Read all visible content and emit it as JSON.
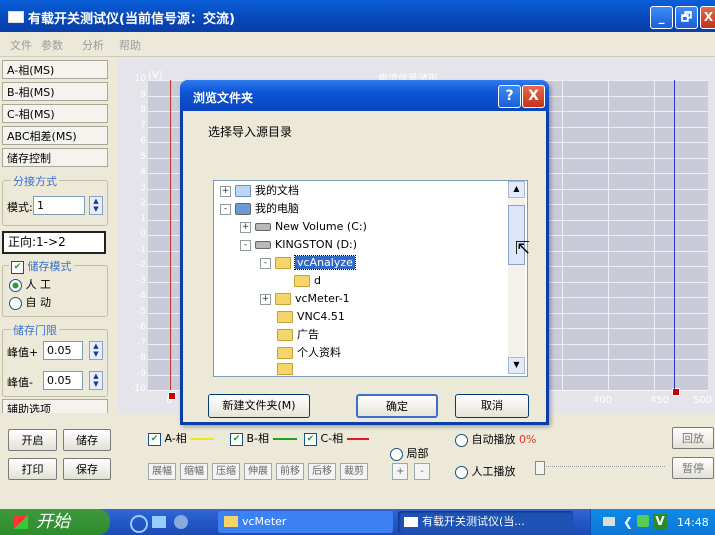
{
  "main_window": {
    "title": "有载开关测试仪(当前信号源：交流)",
    "controls": {
      "minimize": "_",
      "maximize": "🗗",
      "close": "X"
    }
  },
  "menu": [
    "文件",
    "参数",
    "分析",
    "帮助"
  ],
  "left_panel": {
    "buttons": [
      "A-相(MS)",
      "B-相(MS)",
      "C-相(MS)",
      "ABC相差(MS)",
      "储存控制"
    ],
    "split_group": {
      "label": "分接方式",
      "mode_label": "模式:",
      "mode_value": "1"
    },
    "direction": "正向:1->2",
    "storage_mode": {
      "label": "储存模式",
      "options": [
        "人 工",
        "自 动"
      ],
      "selected": 0
    },
    "threshold_group": {
      "label": "储存门限",
      "peak_plus_label": "峰值+",
      "peak_plus_value": "0.05",
      "peak_minus_label": "峰值-",
      "peak_minus_value": "0.05"
    },
    "aux": "辅助选项"
  },
  "chart": {
    "unit_label": "(V)",
    "chart_title": "电流信号波形",
    "yticks": [
      "10",
      "9",
      "8",
      "7",
      "6",
      "5",
      "4",
      "3",
      "2",
      "1",
      "0",
      "-1",
      "-2",
      "-3",
      "-4",
      "-5",
      "-6",
      "-7",
      "-8",
      "-9",
      "-10"
    ],
    "xticks": [
      "0",
      "400",
      "450",
      "500"
    ]
  },
  "bottom": {
    "buttons": {
      "start": "开启",
      "store": "储存",
      "print": "打印",
      "save": "保存"
    },
    "phases": [
      {
        "label": "A-相",
        "color": "#f2e61a"
      },
      {
        "label": "B-相",
        "color": "#21a121"
      },
      {
        "label": "C-相",
        "color": "#e01b1b"
      }
    ],
    "tools": [
      "展幅",
      "缩幅",
      "压缩",
      "伸展",
      "前移",
      "后移",
      "裁剪"
    ],
    "local": "局部",
    "plus": "+",
    "minus": "-",
    "auto_play": "自动播放",
    "auto_pct": "0%",
    "manual_play": "人工播放",
    "replay": "回放",
    "pause": "暂停"
  },
  "dialog": {
    "title": "浏览文件夹",
    "help": "?",
    "close": "X",
    "instruction": "选择导入源目录",
    "tree": [
      {
        "label": "我的文档",
        "level": 0,
        "expander": "+",
        "icon": "documents-folder-icon"
      },
      {
        "label": "我的电脑",
        "level": 0,
        "expander": "-",
        "icon": "computer-icon"
      },
      {
        "label": "New Volume (C:)",
        "level": 1,
        "expander": "+",
        "icon": "drive-icon"
      },
      {
        "label": "KINGSTON (D:)",
        "level": 1,
        "expander": "-",
        "icon": "drive-icon"
      },
      {
        "label": "vcAnalyze",
        "level": 2,
        "expander": "-",
        "icon": "folder-icon",
        "selected": true
      },
      {
        "label": "d",
        "level": 3,
        "expander": "",
        "icon": "folder-icon"
      },
      {
        "label": "vcMeter-1",
        "level": 2,
        "expander": "+",
        "icon": "folder-icon"
      },
      {
        "label": "VNC4.51",
        "level": 2,
        "expander": "",
        "icon": "folder-icon"
      },
      {
        "label": "广告",
        "level": 2,
        "expander": "",
        "icon": "folder-icon"
      },
      {
        "label": "个人资料",
        "level": 2,
        "expander": "",
        "icon": "folder-icon"
      }
    ],
    "buttons": {
      "new_folder": "新建文件夹(M)",
      "ok": "确定",
      "cancel": "取消"
    }
  },
  "taskbar": {
    "start": "开始",
    "tasks": [
      "vcMeter",
      "有载开关测试仪(当..."
    ],
    "clock": "14:48",
    "tray_badge": "V"
  }
}
